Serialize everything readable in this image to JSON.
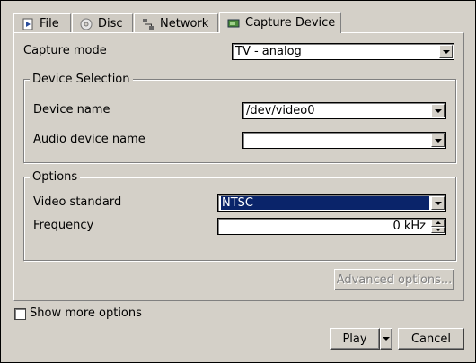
{
  "tabs": [
    {
      "label": "File",
      "icon": "file-icon"
    },
    {
      "label": "Disc",
      "icon": "disc-icon"
    },
    {
      "label": "Network",
      "icon": "network-icon"
    },
    {
      "label": "Capture Device",
      "icon": "capture-device-icon",
      "active": true
    }
  ],
  "capture_mode": {
    "label": "Capture mode",
    "value": "TV - analog"
  },
  "device_selection": {
    "title": "Device Selection",
    "device_name_label": "Device name",
    "device_name_value": "/dev/video0",
    "audio_device_label": "Audio device name",
    "audio_device_value": ""
  },
  "options": {
    "title": "Options",
    "video_standard_label": "Video standard",
    "video_standard_value": "NTSC",
    "frequency_label": "Frequency",
    "frequency_value": "0 kHz"
  },
  "advanced_button": "Advanced options...",
  "show_more": {
    "label": "Show more options",
    "checked": false
  },
  "play_button": "Play",
  "cancel_button": "Cancel"
}
